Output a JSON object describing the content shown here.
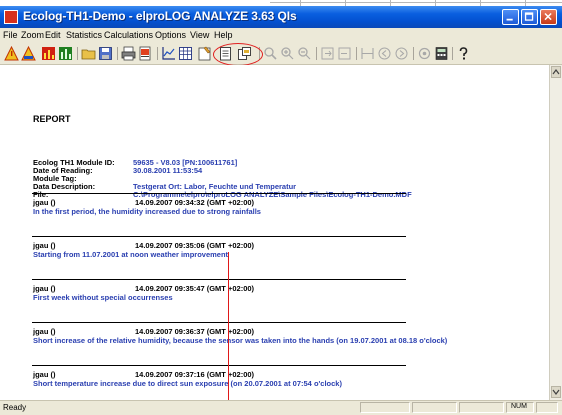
{
  "window": {
    "title": "Ecolog-TH1-Demo - elproLOG ANALYZE 3.63 QIs"
  },
  "menu": {
    "items": [
      "File",
      "Zoom",
      "Edit",
      "Statistics",
      "Calculations",
      "Options",
      "View",
      "Help"
    ]
  },
  "toolbar": {
    "icons": [
      "warning-icon",
      "warning-info-icon",
      "chart-red-icon",
      "chart-green-icon",
      "open-icon",
      "save-icon",
      "print-icon",
      "print-preview-icon",
      "graph-icon",
      "table-icon",
      "comment-icon",
      "report-icon",
      "copy-report-icon",
      "zoom-icon",
      "zoom-in-icon",
      "zoom-out-icon",
      "export-icon",
      "import-icon",
      "marker-icon",
      "back-icon",
      "forward-icon",
      "settings-icon",
      "calculator-icon",
      "help-icon"
    ]
  },
  "report": {
    "heading": "REPORT",
    "fields": [
      {
        "label": "Ecolog TH1 Module ID:",
        "value": "59635 - V8.03 [PN:100611761]"
      },
      {
        "label": "Date of Reading:",
        "value": "30.08.2001  11:53:54"
      },
      {
        "label": "Module Tag:",
        "value": ""
      },
      {
        "label": "Data Description:",
        "value": "Testgerat Ort: Labor, Feuchte und Temperatur"
      },
      {
        "label": "File:",
        "value": "C:\\Programme\\elpro\\elproLOG ANALYZE\\Sample Files\\Ecolog-TH1-Demo.MDF"
      }
    ],
    "entries": [
      {
        "user": "jgau ()",
        "timestamp": "14.09.2007  09:34:32   (GMT +02:00)",
        "text": "In the first period, the humidity increased due to strong rainfalls"
      },
      {
        "user": "jgau ()",
        "timestamp": "14.09.2007  09:35:06   (GMT +02:00)",
        "text": "Starting from 11.07.2001 at noon weather improvement"
      },
      {
        "user": "jgau ()",
        "timestamp": "14.09.2007  09:35:47   (GMT +02:00)",
        "text": "First week without special occurrenses"
      },
      {
        "user": "jgau ()",
        "timestamp": "14.09.2007  09:36:37   (GMT +02:00)",
        "text": "Short increase of the relative humidity, because the sensor was taken into the hands (on 19.07.2001 at 08.18 o'clock)"
      },
      {
        "user": "jgau ()",
        "timestamp": "14.09.2007  09:37:16   (GMT +02:00)",
        "text": "Short temperature increase due to direct sun exposure (on 20.07.2001 at 07:54 o'clock)"
      }
    ]
  },
  "status": {
    "ready": "Ready",
    "num": "NUM"
  },
  "colors": {
    "title_bar": "#0a5fe0",
    "value_text": "#2a3fb0",
    "highlight": "#e02020"
  }
}
